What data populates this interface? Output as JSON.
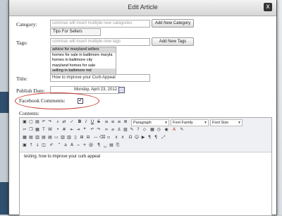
{
  "window": {
    "title": "Edit Article",
    "close_glyph": "x"
  },
  "category": {
    "label": "Category:",
    "placeholder": "commas will insert multiple new categories",
    "add_button": "Add New Category",
    "selected": "Tips For Sellers"
  },
  "tags": {
    "label": "Tags:",
    "placeholder": "commas will insert multiple new tags",
    "add_button": "Add New Tags",
    "options": [
      {
        "text": "advice for maryland sellers",
        "selected": true
      },
      {
        "text": "homes for sale in baltimore maryla",
        "selected": false
      },
      {
        "text": "homes in baltimore city",
        "selected": false
      },
      {
        "text": "maryland homes for sale",
        "selected": false
      },
      {
        "text": "selling in baltimore md",
        "selected": true
      }
    ]
  },
  "title_field": {
    "label": "Title:",
    "value": "How to improve your Curb Appeal"
  },
  "publish_date": {
    "label": "Publish Date:",
    "value": "Monday, April 23, 2012"
  },
  "facebook_comments": {
    "label": "Facebook Comments:",
    "checked": true,
    "check_glyph": "✔"
  },
  "contents": {
    "label": "Contents:",
    "format_select": "Paragraph",
    "font_family_select": "Font Family",
    "font_size_select": "Font Size",
    "body_text": "testing. how to improve your curb appeal"
  },
  "icons": {
    "calendar": "calendar-icon",
    "annotation_color": "#c9372c"
  }
}
